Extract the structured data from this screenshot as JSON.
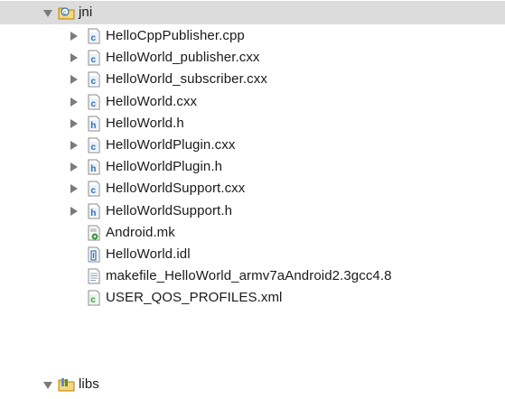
{
  "tree": {
    "jni_folder": {
      "label": "jni",
      "icon": "source-folder-icon",
      "expanded": true,
      "selected": true
    },
    "items": [
      {
        "label": "HelloCppPublisher.cpp",
        "icon": "c-source-file-icon",
        "expandable": true
      },
      {
        "label": "HelloWorld_publisher.cxx",
        "icon": "c-source-file-icon",
        "expandable": true
      },
      {
        "label": "HelloWorld_subscriber.cxx",
        "icon": "c-source-file-icon",
        "expandable": true
      },
      {
        "label": "HelloWorld.cxx",
        "icon": "c-source-file-icon",
        "expandable": true
      },
      {
        "label": "HelloWorld.h",
        "icon": "header-file-icon",
        "expandable": true
      },
      {
        "label": "HelloWorldPlugin.cxx",
        "icon": "c-source-file-icon",
        "expandable": true
      },
      {
        "label": "HelloWorldPlugin.h",
        "icon": "header-file-icon",
        "expandable": true
      },
      {
        "label": "HelloWorldSupport.cxx",
        "icon": "c-source-file-icon",
        "expandable": true
      },
      {
        "label": "HelloWorldSupport.h",
        "icon": "header-file-icon",
        "expandable": true
      },
      {
        "label": "Android.mk",
        "icon": "makefile-icon",
        "expandable": false
      },
      {
        "label": "HelloWorld.idl",
        "icon": "idl-file-icon",
        "expandable": false
      },
      {
        "label": "makefile_HelloWorld_armv7aAndroid2.3gcc4.8",
        "icon": "text-file-icon",
        "expandable": false
      },
      {
        "label": "USER_QOS_PROFILES.xml",
        "icon": "xml-file-icon",
        "expandable": false
      }
    ],
    "libs_folder": {
      "label": "libs",
      "icon": "library-folder-icon",
      "expanded": true
    }
  },
  "colors": {
    "selection": "#dcdcdc",
    "c_icon": "#2f6fb0",
    "h_icon": "#2f6fb0",
    "folder": "#f2c14e",
    "makefile_gear": "#3f9a3f",
    "xml_icon": "#3f9a3f"
  }
}
